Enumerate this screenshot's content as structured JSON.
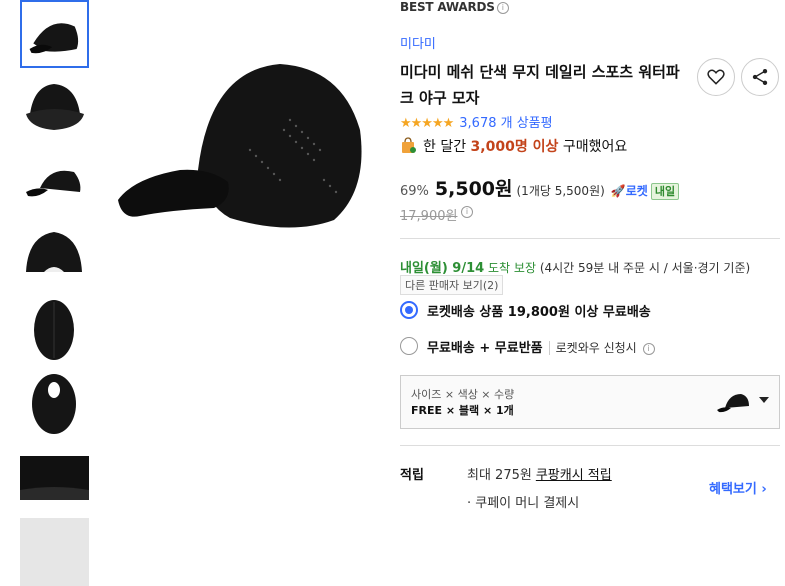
{
  "thumbnails": [
    {
      "name": "thumb-cap-side"
    },
    {
      "name": "thumb-cap-front"
    },
    {
      "name": "thumb-cap-profile"
    },
    {
      "name": "thumb-cap-back"
    },
    {
      "name": "thumb-cap-top"
    },
    {
      "name": "thumb-cap-under"
    },
    {
      "name": "thumb-cap-detail"
    }
  ],
  "product": {
    "award": "BEST AWARDS",
    "brand": "미다미",
    "title": "미다미 메쉬 단색 무지 데일리 스포츠 워터파크 야구 모자",
    "stars": "★★★★★",
    "review_count": "3,678 개 상품평",
    "monthly_prefix": "한 달간",
    "monthly_count": "3,000명 이상",
    "monthly_suffix": "구매했어요"
  },
  "price": {
    "discount": "69%",
    "sale": "5,500원",
    "unit": "(1개당 5,500원)",
    "rocket": "로켓",
    "rocket_badge": "내일",
    "original": "17,900원"
  },
  "delivery": {
    "date": "내일(월) 9/14",
    "guarantee": "도착 보장",
    "detail": "(4시간 59분 내 주문 시 / 서울·경기 기준)",
    "other_sellers": "다른 판매자 보기(2)"
  },
  "shipping_options": [
    {
      "label": "로켓배송 상품 19,800원 이상 무료배송",
      "selected": true
    },
    {
      "label": "무료배송 + 무료반품",
      "sub": "로켓와우 신청시"
    }
  ],
  "option_select": {
    "label": "사이즈 × 색상 × 수량",
    "value": "FREE × 블랙 × 1개"
  },
  "benefits": {
    "label": "적립",
    "line1_prefix": "최대 275원",
    "line1_link": "쿠팡캐시 적립",
    "line2": "· 쿠페이 머니 결제시",
    "more": "혜택보기 ›"
  },
  "colors": {
    "accent": "#346aff",
    "highlight": "#c3431a",
    "green": "#2d8f35"
  }
}
